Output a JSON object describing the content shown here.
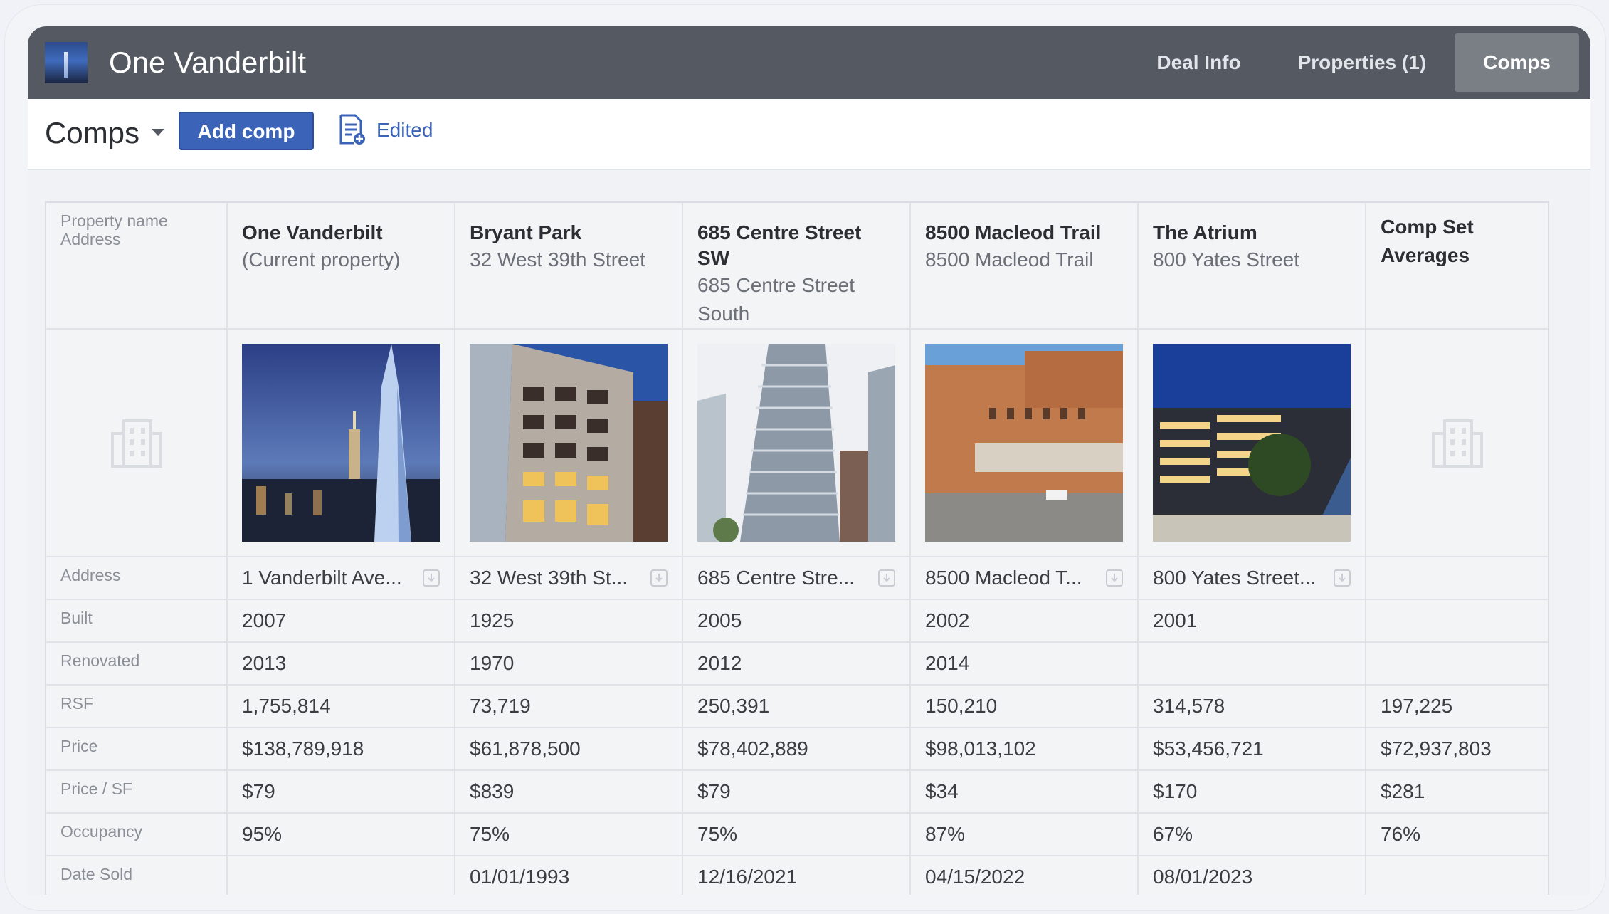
{
  "app": {
    "title": "One Vanderbilt"
  },
  "nav": {
    "tabs": [
      "Deal Info",
      "Properties (1)",
      "Comps"
    ],
    "active": "Comps"
  },
  "subbar": {
    "title": "Comps",
    "add_label": "Add comp",
    "edited_label": "Edited"
  },
  "table": {
    "header_label_1": "Property name",
    "header_label_2": "Address",
    "columns": [
      {
        "name": "One Vanderbilt",
        "sub": "(Current property)",
        "photo": "skyscraper-night"
      },
      {
        "name": "Bryant Park",
        "sub": "32 West 39th Street",
        "photo": "tower-facade"
      },
      {
        "name": "685 Centre Street SW",
        "sub": "685 Centre Street South",
        "photo": "glass-tower"
      },
      {
        "name": "8500 Macleod Trail",
        "sub": "8500 Macleod Trail",
        "photo": "brick-building"
      },
      {
        "name": "The Atrium",
        "sub": "800 Yates Street",
        "photo": "atrium-night"
      }
    ],
    "averages_header": "Comp Set Averages",
    "rows": [
      {
        "label": "Address",
        "values": [
          "1 Vanderbilt Ave...",
          "32 West 39th St...",
          "685 Centre Stre...",
          "8500 Macleod T...",
          "800 Yates Street..."
        ],
        "avg": ""
      },
      {
        "label": "Built",
        "values": [
          "2007",
          "1925",
          "2005",
          "2002",
          "2001"
        ],
        "avg": ""
      },
      {
        "label": "Renovated",
        "values": [
          "2013",
          "1970",
          "2012",
          "2014",
          ""
        ],
        "avg": ""
      },
      {
        "label": "RSF",
        "values": [
          "1,755,814",
          "73,719",
          "250,391",
          "150,210",
          "314,578"
        ],
        "avg": "197,225"
      },
      {
        "label": "Price",
        "values": [
          "$138,789,918",
          "$61,878,500",
          "$78,402,889",
          "$98,013,102",
          "$53,456,721"
        ],
        "avg": "$72,937,803"
      },
      {
        "label": "Price / SF",
        "values": [
          "$79",
          "$839",
          "$79",
          "$34",
          "$170"
        ],
        "avg": "$281"
      },
      {
        "label": "Occupancy",
        "values": [
          "95%",
          "75%",
          "75%",
          "87%",
          "67%"
        ],
        "avg": "76%"
      },
      {
        "label": "Date Sold",
        "values": [
          "",
          "01/01/1993",
          "12/16/2021",
          "04/15/2022",
          "08/01/2023"
        ],
        "avg": ""
      }
    ]
  },
  "colors": {
    "header_bg": "#555a62",
    "accent": "#3b63b8"
  }
}
